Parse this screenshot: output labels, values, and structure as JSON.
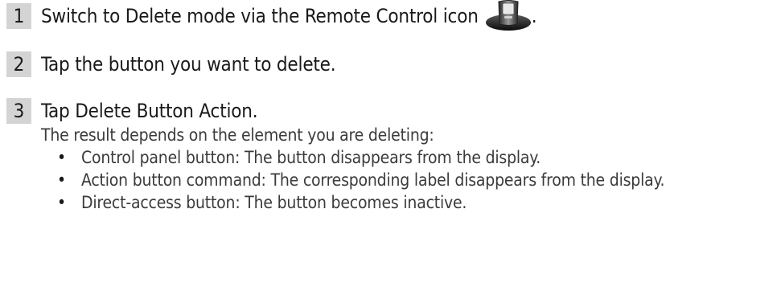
{
  "steps": [
    {
      "number": "1",
      "text": "Switch to Delete mode via the Remote Control icon",
      "trailing": ".",
      "icon": "remote-control-icon"
    },
    {
      "number": "2",
      "text": "Tap the button you want to delete."
    },
    {
      "number": "3",
      "text": "Tap Delete Button Action.",
      "subtext": "The result depends on the element you are deleting:",
      "bullets": [
        "Control panel button: The button disappears from the display.",
        "Action button command: The corresponding label disappears from the display.",
        "Direct-access button: The button becomes inactive."
      ]
    }
  ],
  "colors": {
    "number_box": "#d4d4d4",
    "text": "#1a1a1a",
    "subtext": "#3b3b3b"
  }
}
